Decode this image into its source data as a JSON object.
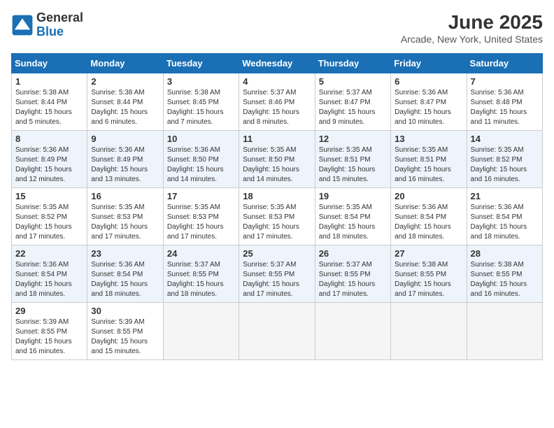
{
  "header": {
    "logo_general": "General",
    "logo_blue": "Blue",
    "month_title": "June 2025",
    "location": "Arcade, New York, United States"
  },
  "weekdays": [
    "Sunday",
    "Monday",
    "Tuesday",
    "Wednesday",
    "Thursday",
    "Friday",
    "Saturday"
  ],
  "weeks": [
    [
      {
        "day": "1",
        "info": "Sunrise: 5:38 AM\nSunset: 8:44 PM\nDaylight: 15 hours\nand 5 minutes."
      },
      {
        "day": "2",
        "info": "Sunrise: 5:38 AM\nSunset: 8:44 PM\nDaylight: 15 hours\nand 6 minutes."
      },
      {
        "day": "3",
        "info": "Sunrise: 5:38 AM\nSunset: 8:45 PM\nDaylight: 15 hours\nand 7 minutes."
      },
      {
        "day": "4",
        "info": "Sunrise: 5:37 AM\nSunset: 8:46 PM\nDaylight: 15 hours\nand 8 minutes."
      },
      {
        "day": "5",
        "info": "Sunrise: 5:37 AM\nSunset: 8:47 PM\nDaylight: 15 hours\nand 9 minutes."
      },
      {
        "day": "6",
        "info": "Sunrise: 5:36 AM\nSunset: 8:47 PM\nDaylight: 15 hours\nand 10 minutes."
      },
      {
        "day": "7",
        "info": "Sunrise: 5:36 AM\nSunset: 8:48 PM\nDaylight: 15 hours\nand 11 minutes."
      }
    ],
    [
      {
        "day": "8",
        "info": "Sunrise: 5:36 AM\nSunset: 8:49 PM\nDaylight: 15 hours\nand 12 minutes."
      },
      {
        "day": "9",
        "info": "Sunrise: 5:36 AM\nSunset: 8:49 PM\nDaylight: 15 hours\nand 13 minutes."
      },
      {
        "day": "10",
        "info": "Sunrise: 5:36 AM\nSunset: 8:50 PM\nDaylight: 15 hours\nand 14 minutes."
      },
      {
        "day": "11",
        "info": "Sunrise: 5:35 AM\nSunset: 8:50 PM\nDaylight: 15 hours\nand 14 minutes."
      },
      {
        "day": "12",
        "info": "Sunrise: 5:35 AM\nSunset: 8:51 PM\nDaylight: 15 hours\nand 15 minutes."
      },
      {
        "day": "13",
        "info": "Sunrise: 5:35 AM\nSunset: 8:51 PM\nDaylight: 15 hours\nand 16 minutes."
      },
      {
        "day": "14",
        "info": "Sunrise: 5:35 AM\nSunset: 8:52 PM\nDaylight: 15 hours\nand 16 minutes."
      }
    ],
    [
      {
        "day": "15",
        "info": "Sunrise: 5:35 AM\nSunset: 8:52 PM\nDaylight: 15 hours\nand 17 minutes."
      },
      {
        "day": "16",
        "info": "Sunrise: 5:35 AM\nSunset: 8:53 PM\nDaylight: 15 hours\nand 17 minutes."
      },
      {
        "day": "17",
        "info": "Sunrise: 5:35 AM\nSunset: 8:53 PM\nDaylight: 15 hours\nand 17 minutes."
      },
      {
        "day": "18",
        "info": "Sunrise: 5:35 AM\nSunset: 8:53 PM\nDaylight: 15 hours\nand 17 minutes."
      },
      {
        "day": "19",
        "info": "Sunrise: 5:35 AM\nSunset: 8:54 PM\nDaylight: 15 hours\nand 18 minutes."
      },
      {
        "day": "20",
        "info": "Sunrise: 5:36 AM\nSunset: 8:54 PM\nDaylight: 15 hours\nand 18 minutes."
      },
      {
        "day": "21",
        "info": "Sunrise: 5:36 AM\nSunset: 8:54 PM\nDaylight: 15 hours\nand 18 minutes."
      }
    ],
    [
      {
        "day": "22",
        "info": "Sunrise: 5:36 AM\nSunset: 8:54 PM\nDaylight: 15 hours\nand 18 minutes."
      },
      {
        "day": "23",
        "info": "Sunrise: 5:36 AM\nSunset: 8:54 PM\nDaylight: 15 hours\nand 18 minutes."
      },
      {
        "day": "24",
        "info": "Sunrise: 5:37 AM\nSunset: 8:55 PM\nDaylight: 15 hours\nand 18 minutes."
      },
      {
        "day": "25",
        "info": "Sunrise: 5:37 AM\nSunset: 8:55 PM\nDaylight: 15 hours\nand 17 minutes."
      },
      {
        "day": "26",
        "info": "Sunrise: 5:37 AM\nSunset: 8:55 PM\nDaylight: 15 hours\nand 17 minutes."
      },
      {
        "day": "27",
        "info": "Sunrise: 5:38 AM\nSunset: 8:55 PM\nDaylight: 15 hours\nand 17 minutes."
      },
      {
        "day": "28",
        "info": "Sunrise: 5:38 AM\nSunset: 8:55 PM\nDaylight: 15 hours\nand 16 minutes."
      }
    ],
    [
      {
        "day": "29",
        "info": "Sunrise: 5:39 AM\nSunset: 8:55 PM\nDaylight: 15 hours\nand 16 minutes."
      },
      {
        "day": "30",
        "info": "Sunrise: 5:39 AM\nSunset: 8:55 PM\nDaylight: 15 hours\nand 15 minutes."
      },
      {
        "day": "",
        "info": ""
      },
      {
        "day": "",
        "info": ""
      },
      {
        "day": "",
        "info": ""
      },
      {
        "day": "",
        "info": ""
      },
      {
        "day": "",
        "info": ""
      }
    ]
  ]
}
